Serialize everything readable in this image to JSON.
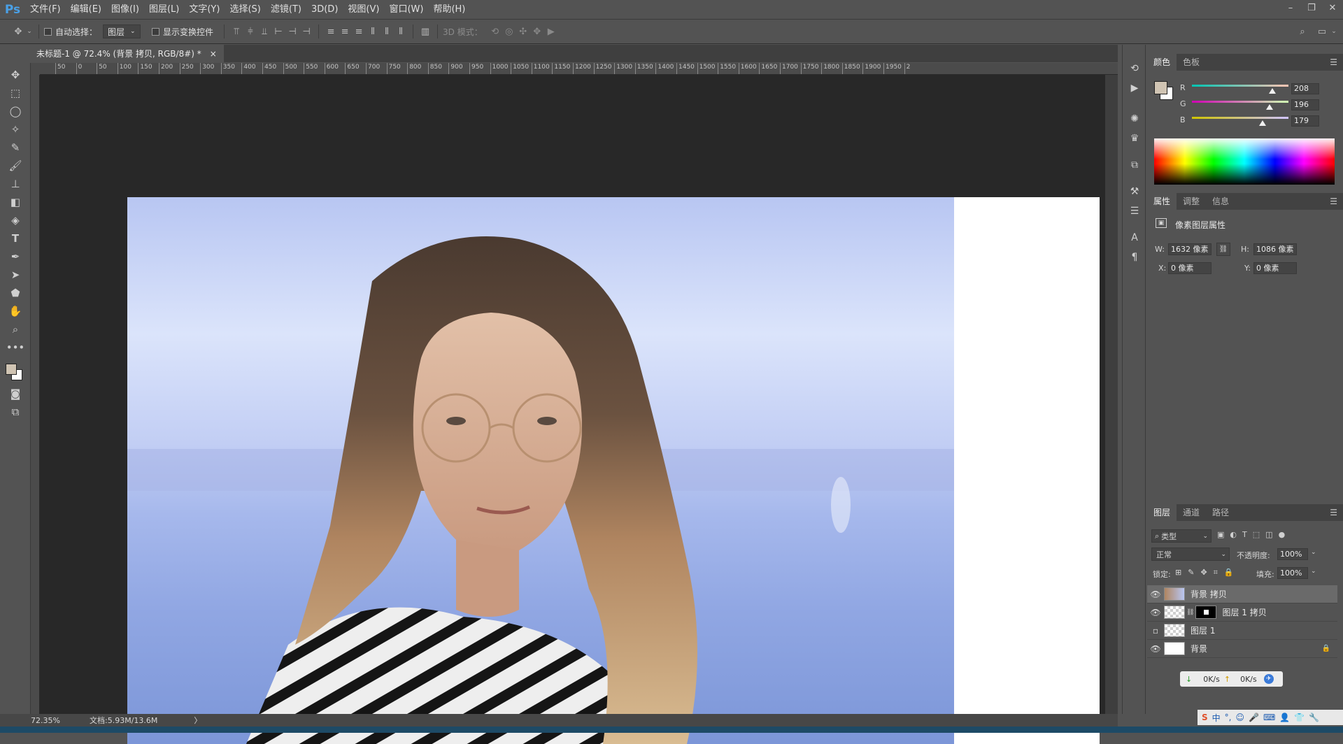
{
  "app": {
    "logo": "Ps"
  },
  "menu": [
    "文件(F)",
    "编辑(E)",
    "图像(I)",
    "图层(L)",
    "文字(Y)",
    "选择(S)",
    "滤镜(T)",
    "3D(D)",
    "视图(V)",
    "窗口(W)",
    "帮助(H)"
  ],
  "options": {
    "auto_select_label": "自动选择：",
    "auto_select_value": "图层",
    "show_transform_label": "显示变换控件",
    "mode_3d_label": "3D 模式："
  },
  "document": {
    "tab_title": "未标题-1 @ 72.4% (背景 拷贝, RGB/8#) *",
    "close": "×"
  },
  "ruler": {
    "h_ticks": [
      "50",
      "0",
      "50",
      "100",
      "150",
      "200",
      "250",
      "300",
      "350",
      "400",
      "450",
      "500",
      "550",
      "600",
      "650",
      "700",
      "750",
      "800",
      "850",
      "900",
      "950",
      "1000",
      "1050",
      "1100",
      "1150",
      "1200",
      "1250",
      "1300",
      "1350",
      "1400",
      "1450",
      "1500",
      "1550",
      "1600",
      "1650",
      "1700",
      "1750",
      "1800",
      "1850",
      "1900",
      "1950",
      "2"
    ]
  },
  "status": {
    "zoom": "72.35%",
    "doc_size": "文档:5.93M/13.6M",
    "arrow": "〉"
  },
  "color_panel": {
    "tabs": [
      "颜色",
      "色板"
    ],
    "foreground": "#d0c4b3",
    "background": "#ffffff",
    "r_label": "R",
    "r": "208",
    "g_label": "G",
    "g": "196",
    "b_label": "B",
    "b": "179"
  },
  "properties_panel": {
    "tabs": [
      "属性",
      "调整",
      "信息"
    ],
    "title": "像素图层属性",
    "w_label": "W:",
    "w": "1632 像素",
    "h_label": "H:",
    "h": "1086 像素",
    "x_label": "X:",
    "x": "0 像素",
    "y_label": "Y:",
    "y": "0 像素"
  },
  "layers_panel": {
    "tabs": [
      "图层",
      "通道",
      "路径"
    ],
    "filter_value": "类型",
    "blend_mode": "正常",
    "opacity_label": "不透明度:",
    "opacity": "100%",
    "lock_label": "锁定:",
    "fill_label": "填充:",
    "fill": "100%",
    "layers": [
      {
        "name": "背景 拷贝",
        "visible": true
      },
      {
        "name": "图层 1 拷贝",
        "visible": true
      },
      {
        "name": "图层 1",
        "visible": false
      },
      {
        "name": "背景",
        "visible": true
      }
    ]
  },
  "net_widget": {
    "down": "0K/s",
    "up": "0K/s"
  },
  "ime": {
    "label": "中"
  }
}
